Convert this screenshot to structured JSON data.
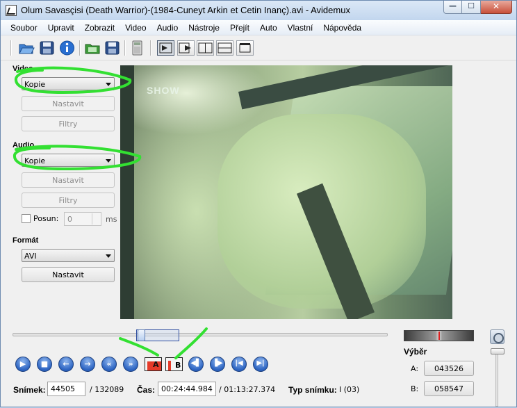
{
  "window": {
    "title": "Olum Savasçisi (Death Warrior)-(1984-Cuneyt Arkin et Cetin Inanç).avi - Avidemux",
    "minimize_glyph": "—",
    "maximize_glyph": "☐",
    "close_glyph": "✕"
  },
  "menu": [
    "Soubor",
    "Upravit",
    "Zobrazit",
    "Video",
    "Audio",
    "Nástroje",
    "Přejít",
    "Auto",
    "Vlastní",
    "Nápověda"
  ],
  "video": {
    "label": "Video",
    "codec": "Kopie",
    "configure": "Nastavit",
    "filters": "Filtry"
  },
  "audio": {
    "label": "Audio",
    "codec": "Kopie",
    "configure": "Nastavit",
    "filters": "Filtry",
    "shift_label": "Posun:",
    "shift_value": "0",
    "shift_unit": "ms"
  },
  "format": {
    "label": "Formát",
    "container": "AVI",
    "configure": "Nastavit"
  },
  "video_overlay_text": "SHOW",
  "markers": {
    "a": "A",
    "b": "B"
  },
  "status": {
    "frame_label": "Snímek:",
    "frame_value": "44505",
    "frame_total": "/ 132089",
    "time_label": "Čas:",
    "time_value": "00:24:44.984",
    "time_total": "/ 01:13:27.374",
    "frame_type_label": "Typ snímku:",
    "frame_type_value": "I (03)"
  },
  "selection": {
    "label": "Výběr",
    "a_label": "A:",
    "a_value": "043526",
    "b_label": "B:",
    "b_value": "058547"
  },
  "timeline_position": 0.341
}
